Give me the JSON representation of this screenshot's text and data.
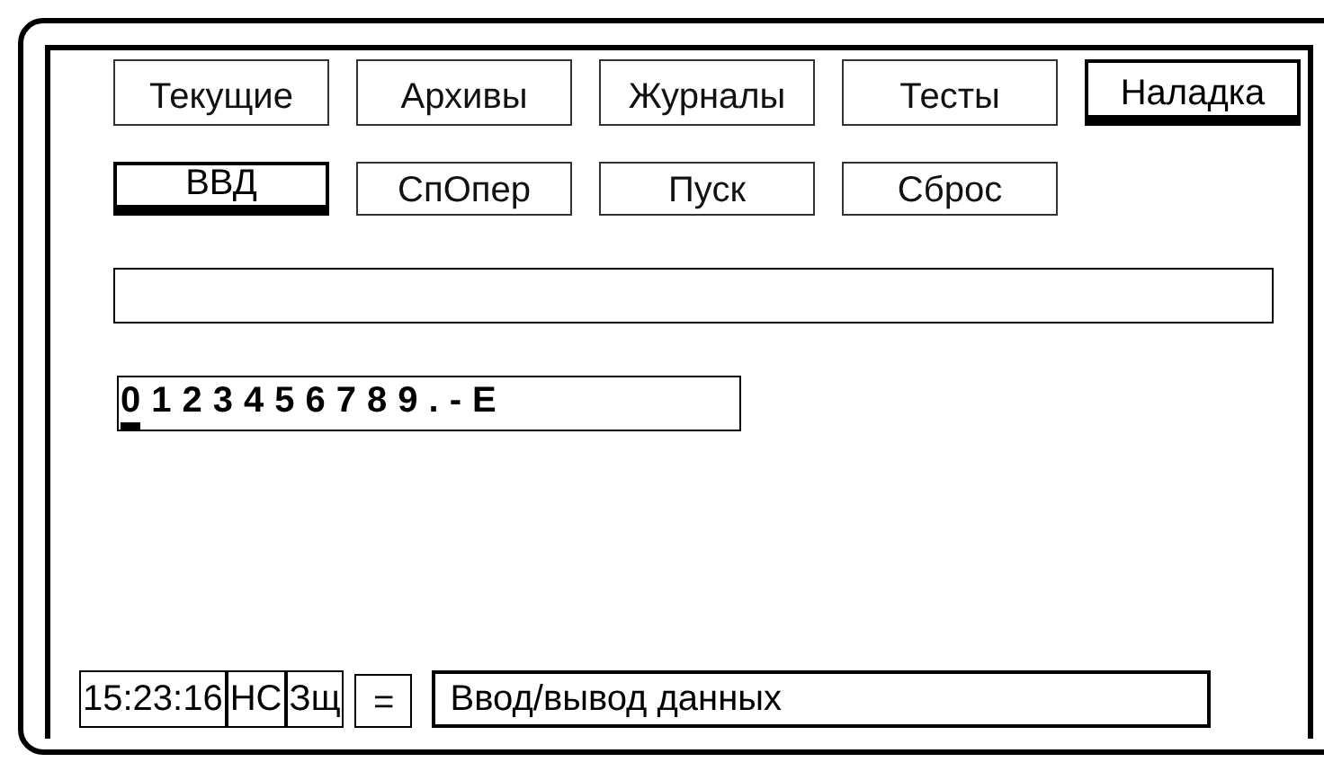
{
  "tabs": [
    {
      "label": "Текущие",
      "selected": false
    },
    {
      "label": "Архивы",
      "selected": false
    },
    {
      "label": "Журналы",
      "selected": false
    },
    {
      "label": "Тесты",
      "selected": false
    },
    {
      "label": "Наладка",
      "selected": true
    }
  ],
  "subtabs": [
    {
      "label": "ВВД",
      "selected": true
    },
    {
      "label": "СпОпер",
      "selected": false
    },
    {
      "label": "Пуск",
      "selected": false
    },
    {
      "label": "Сброс",
      "selected": false
    }
  ],
  "characters": [
    {
      "char": "0",
      "selected": true
    },
    {
      "char": "1",
      "selected": false
    },
    {
      "char": "2",
      "selected": false
    },
    {
      "char": "3",
      "selected": false
    },
    {
      "char": "4",
      "selected": false
    },
    {
      "char": "5",
      "selected": false
    },
    {
      "char": "6",
      "selected": false
    },
    {
      "char": "7",
      "selected": false
    },
    {
      "char": "8",
      "selected": false
    },
    {
      "char": "9",
      "selected": false
    },
    {
      "char": ".",
      "selected": false
    },
    {
      "char": "-",
      "selected": false
    },
    {
      "char": "E",
      "selected": false
    }
  ],
  "status_bar": {
    "time": "15:23:16",
    "flags": [
      "НС",
      "Зщ"
    ],
    "key": "=",
    "message": "Ввод/вывод данных"
  }
}
